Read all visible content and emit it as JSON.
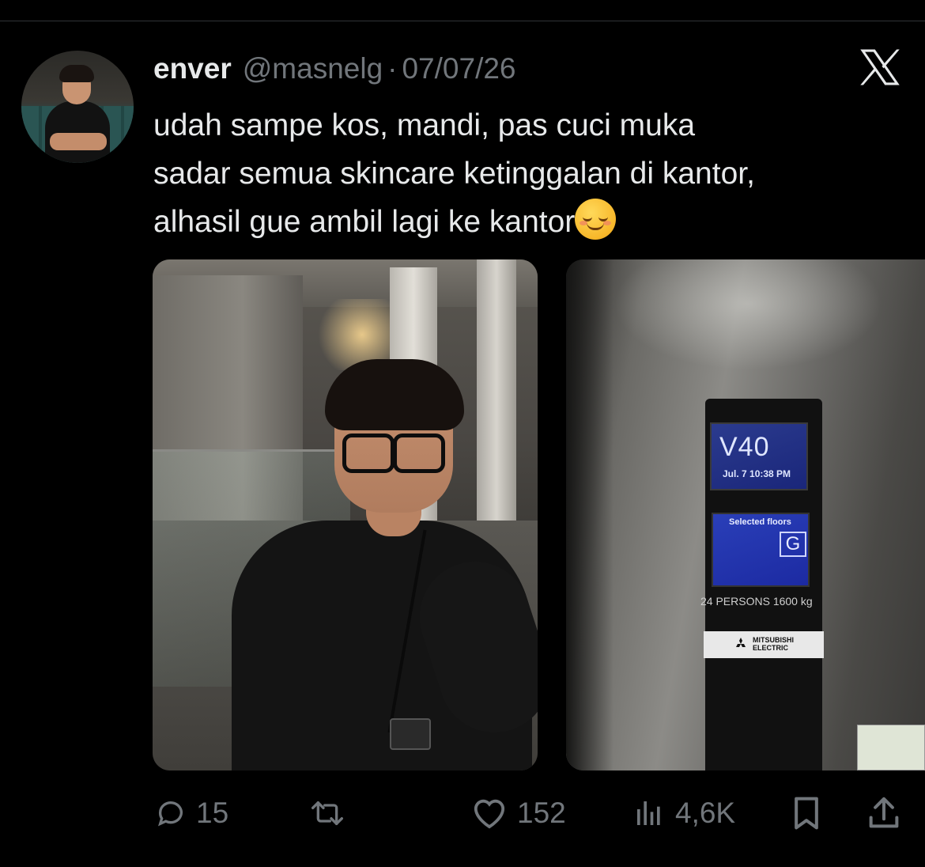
{
  "tweet": {
    "author": {
      "display_name": "enver",
      "handle": "@masnelg",
      "separator": "·",
      "date": "07/07/26"
    },
    "text_lines": [
      "udah sampe kos, mandi, pas cuci muka",
      "sadar semua skincare ketinggalan di kantor,",
      "alhasil gue ambil lagi ke kantor"
    ],
    "emoji": "smiling-face-with-smiling-eyes",
    "media": [
      {
        "description_icon": "selfie-photo"
      },
      {
        "description_icon": "elevator-panel-photo",
        "panel": {
          "floor": "V40",
          "datetime": "Jul.  7 10:38 PM",
          "selected_label": "Selected floors",
          "selected_floor": "G",
          "capacity": "24 PERSONS   1600 kg",
          "brand": "MITSUBISHI ELECTRIC"
        }
      }
    ],
    "actions": {
      "replies": "15",
      "retweets": "",
      "likes": "152",
      "views": "4,6K"
    }
  },
  "colors": {
    "background": "#000000",
    "text_primary": "#e7e9ea",
    "text_secondary": "#71767b"
  }
}
